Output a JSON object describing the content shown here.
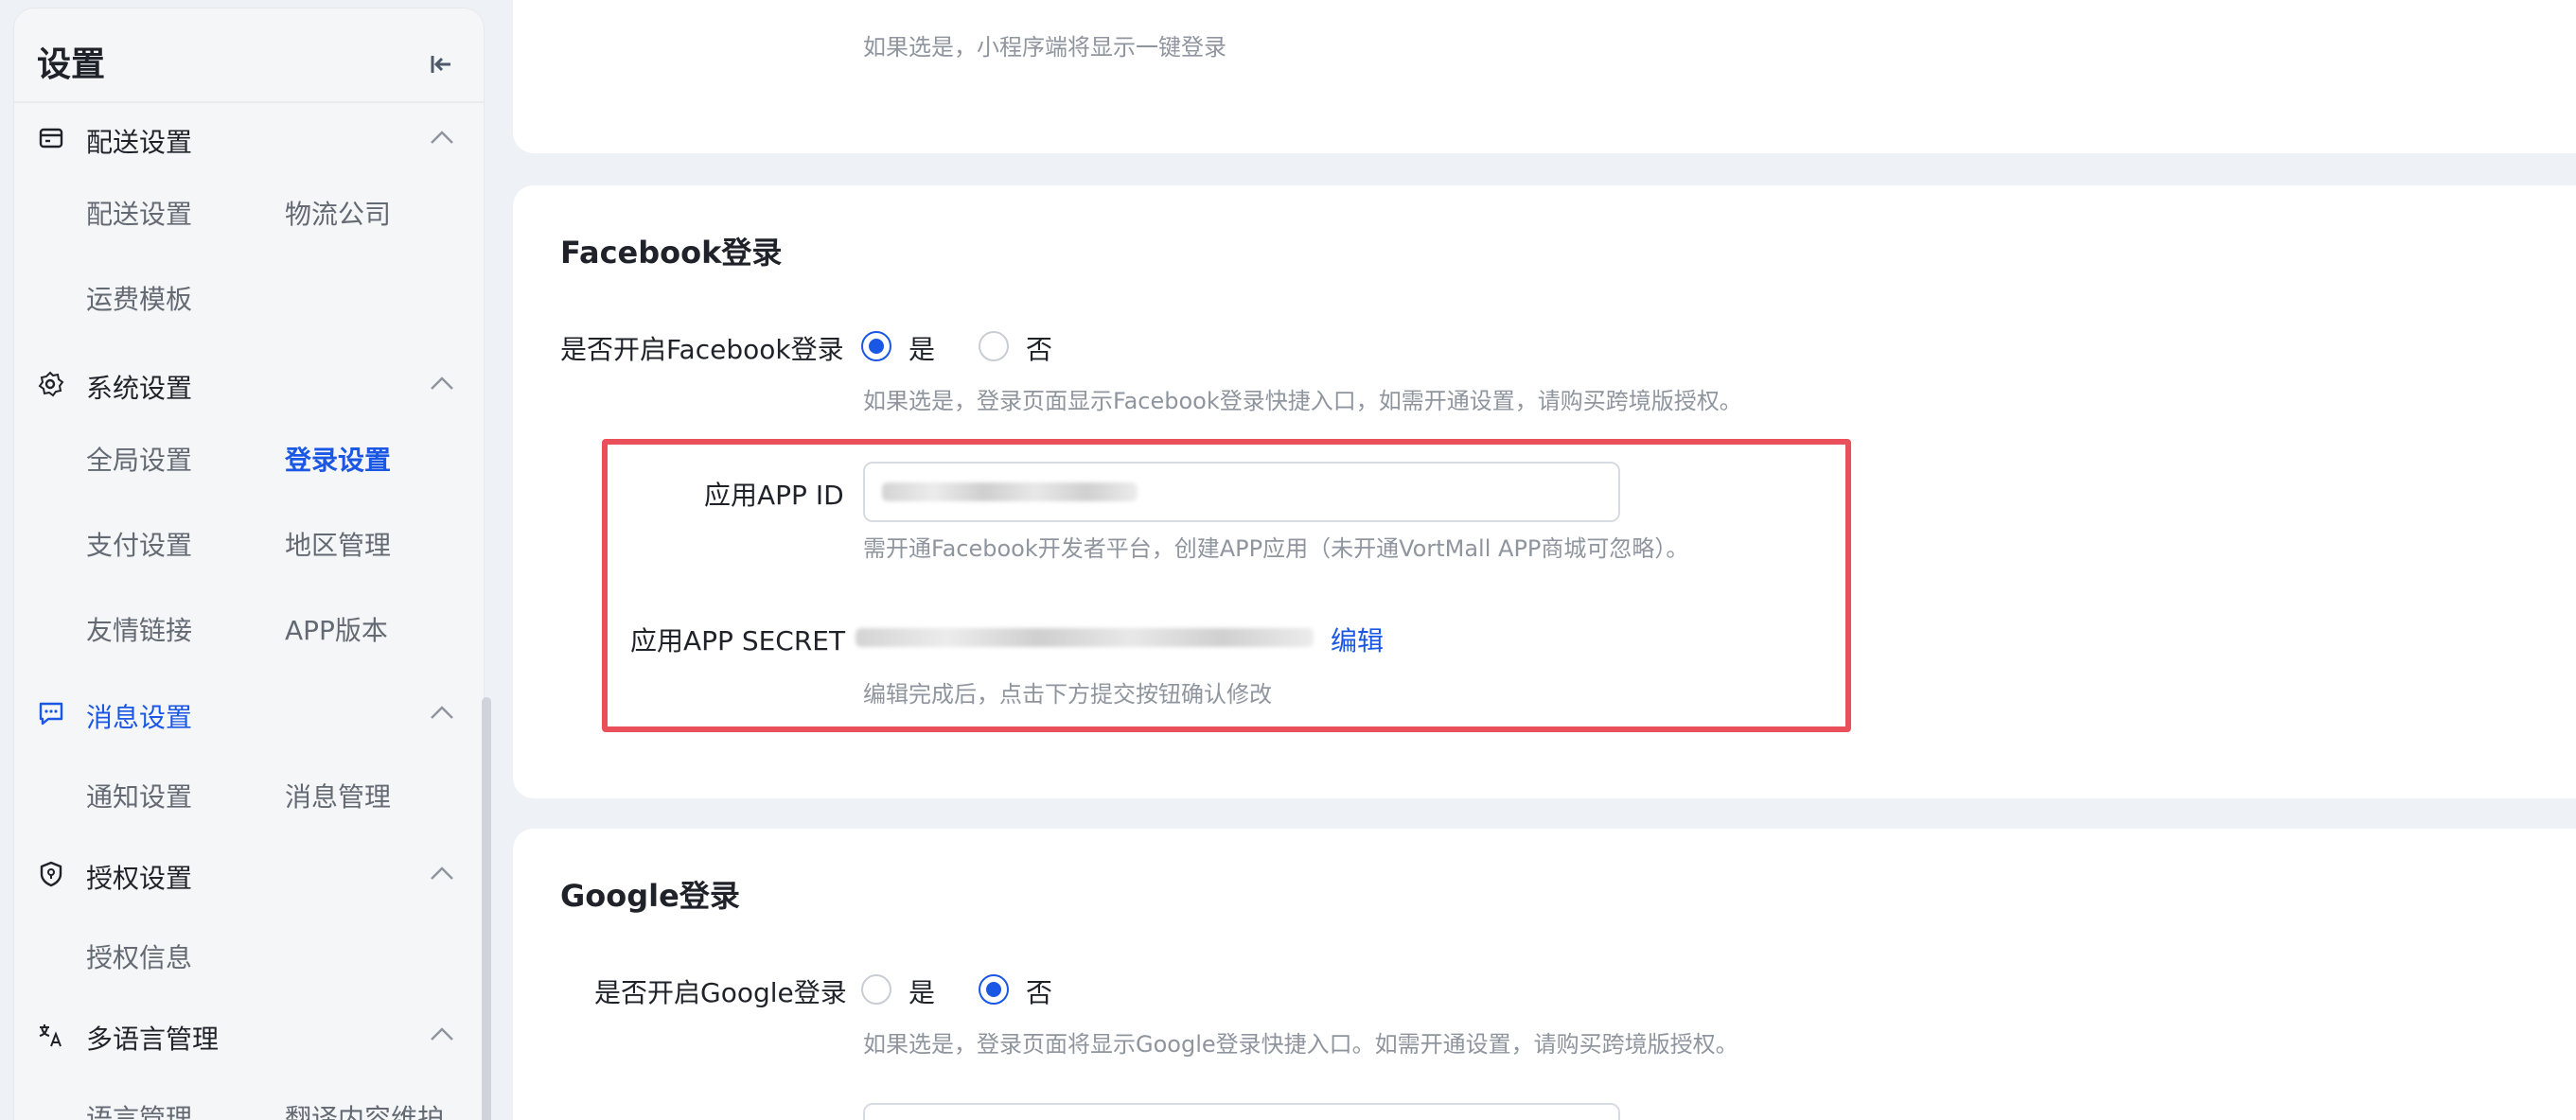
{
  "sidebar": {
    "title": "设置",
    "groups": [
      {
        "label": "配送设置",
        "icon": "delivery-icon",
        "items": [
          "配送设置",
          "物流公司",
          "运费模板"
        ]
      },
      {
        "label": "系统设置",
        "icon": "gear-icon",
        "items": [
          "全局设置",
          "登录设置",
          "支付设置",
          "地区管理",
          "友情链接",
          "APP版本"
        ]
      },
      {
        "label": "消息设置",
        "icon": "message-icon",
        "items": [
          "通知设置",
          "消息管理"
        ]
      },
      {
        "label": "授权设置",
        "icon": "shield-icon",
        "items": [
          "授权信息"
        ]
      },
      {
        "label": "多语言管理",
        "icon": "translate-icon",
        "items": [
          "语言管理",
          "翻译内容维护"
        ]
      }
    ],
    "active_item": "登录设置",
    "active_group": "消息设置"
  },
  "top_card": {
    "hint": "如果选是，小程序端将显示一键登录"
  },
  "facebook": {
    "title": "Facebook登录",
    "enable_label": "是否开启Facebook登录",
    "yes": "是",
    "no": "否",
    "selected": "是",
    "enable_hint": "如果选是，登录页面显示Facebook登录快捷入口，如需开通设置，请购买跨境版授权。",
    "app_id_label": "应用APP ID",
    "app_id_hint": "需开通Facebook开发者平台，创建APP应用（未开通VortMall APP商城可忽略）。",
    "app_secret_label": "应用APP SECRET",
    "edit_link": "编辑",
    "app_secret_hint": "编辑完成后，点击下方提交按钮确认修改"
  },
  "google": {
    "title": "Google登录",
    "enable_label": "是否开启Google登录",
    "yes": "是",
    "no": "否",
    "selected": "否",
    "enable_hint": "如果选是，登录页面将显示Google登录快捷入口。如需开通设置，请购买跨境版授权。"
  },
  "colors": {
    "accent": "#1a57e4",
    "highlight": "#e9505a",
    "background": "#eef1f6"
  }
}
